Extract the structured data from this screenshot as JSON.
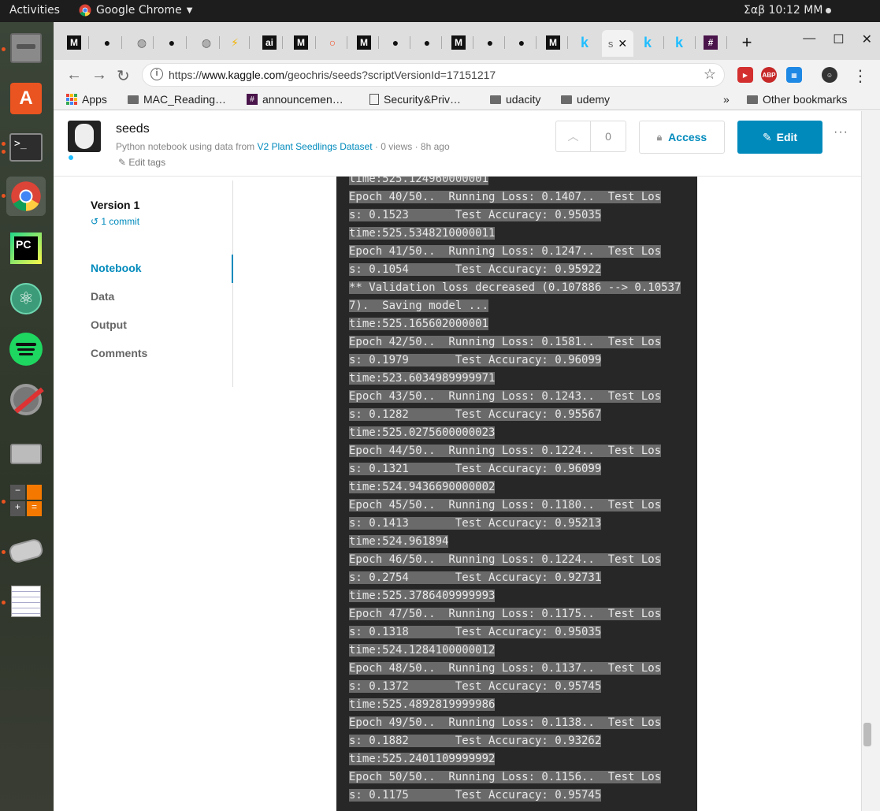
{
  "topbar": {
    "activities": "Activities",
    "app_name": "Google Chrome",
    "clock": "Σαβ 10:12 ΜΜ"
  },
  "dock": {
    "items": [
      "files-icon",
      "software-center-icon",
      "terminal-icon",
      "chrome-icon",
      "pycharm-icon",
      "atom-icon",
      "spotify-icon",
      "settings-icon",
      "disk-utility-icon",
      "calculator-icon",
      "scanner-icon",
      "text-editor-icon"
    ]
  },
  "tabs": {
    "active_label": "s",
    "favicons": [
      "M",
      "gh",
      "web",
      "gh",
      "web",
      "bolt",
      "ai",
      "M",
      "circle",
      "M",
      "gh",
      "gh",
      "M",
      "gh",
      "gh",
      "M",
      "k",
      "s",
      "k",
      "k",
      "slack"
    ]
  },
  "omnibox": {
    "url_prefix": "https://",
    "url_domain": "www.kaggle.com",
    "url_path": "/geochris/seeds?scriptVersionId=17151217"
  },
  "bookmarks": {
    "apps": "Apps",
    "items": [
      "MAC_Reading…",
      "announcemen…",
      "Security&Priv…",
      "udacity",
      "udemy"
    ],
    "chevron": "»",
    "other": "Other bookmarks"
  },
  "kernel": {
    "title": "seeds",
    "subtitle_prefix": "Python notebook using data from",
    "dataset": "V2 Plant Seedlings Dataset",
    "subtitle_suffix": "· 0 views · 8h ago",
    "edit_tags": "Edit tags",
    "vote_count": "0",
    "access_label": "Access",
    "edit_label": "Edit",
    "more": "···"
  },
  "sidebar": {
    "version": "Version 1",
    "commit": "1 commit",
    "nav": [
      "Notebook",
      "Data",
      "Output",
      "Comments"
    ],
    "selected": "Notebook"
  },
  "log_lines": [
    "time:525.124960000001",
    "Epoch 40/50..  Running Loss: 0.1407..  Test Los",
    "s: 0.1523       Test Accuracy: 0.95035",
    "time:525.5348210000011",
    "Epoch 41/50..  Running Loss: 0.1247..  Test Los",
    "s: 0.1054       Test Accuracy: 0.95922",
    "** Validation loss decreased (0.107886 --> 0.10537",
    "7).  Saving model ...",
    "time:525.165602000001",
    "Epoch 42/50..  Running Loss: 0.1581..  Test Los",
    "s: 0.1979       Test Accuracy: 0.96099",
    "time:523.6034989999971",
    "Epoch 43/50..  Running Loss: 0.1243..  Test Los",
    "s: 0.1282       Test Accuracy: 0.95567",
    "time:525.0275600000023",
    "Epoch 44/50..  Running Loss: 0.1224..  Test Los",
    "s: 0.1321       Test Accuracy: 0.96099",
    "time:524.9436690000002",
    "Epoch 45/50..  Running Loss: 0.1180..  Test Los",
    "s: 0.1413       Test Accuracy: 0.95213",
    "time:524.961894",
    "Epoch 46/50..  Running Loss: 0.1224..  Test Los",
    "s: 0.2754       Test Accuracy: 0.92731",
    "time:525.3786409999993",
    "Epoch 47/50..  Running Loss: 0.1175..  Test Los",
    "s: 0.1318       Test Accuracy: 0.95035",
    "time:524.1284100000012",
    "Epoch 48/50..  Running Loss: 0.1137..  Test Los",
    "s: 0.1372       Test Accuracy: 0.95745",
    "time:525.4892819999986",
    "Epoch 49/50..  Running Loss: 0.1138..  Test Los",
    "s: 0.1882       Test Accuracy: 0.93262",
    "time:525.2401109999992",
    "Epoch 50/50..  Running Loss: 0.1156..  Test Los",
    "s: 0.1175       Test Accuracy: 0.95745"
  ],
  "colors": {
    "kaggle_blue": "#008abc",
    "console_bg": "#272727",
    "selection": "#6a6a6a"
  }
}
